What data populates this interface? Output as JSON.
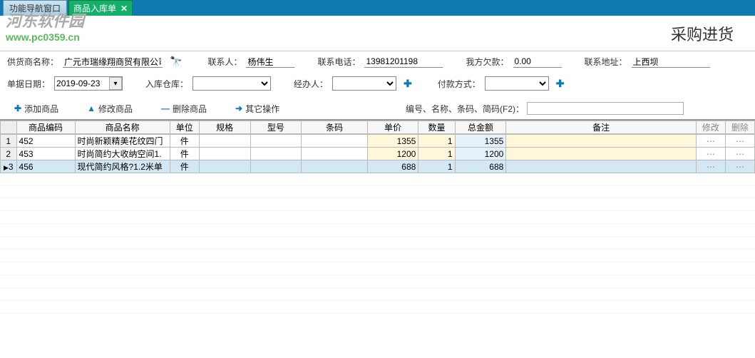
{
  "tabs": {
    "inactive": "功能导航窗口",
    "active": "商品入库单",
    "close": "✕"
  },
  "watermark": {
    "cn": "河东软件园",
    "url": "www.pc0359.cn"
  },
  "page_title": "采购进货",
  "form": {
    "supplier_lbl": "供货商名称：",
    "supplier": "广元市瑞缘翔商贸有限公司",
    "contact_lbl": "联系人：",
    "contact": "杨伟生",
    "phone_lbl": "联系电话：",
    "phone": "13981201198",
    "debt_lbl": "我方欠款：",
    "debt": "0.00",
    "addr_lbl": "联系地址：",
    "addr": "上西坝",
    "date_lbl": "单据日期：",
    "date": "2019-09-23",
    "wh_lbl": "入库仓库：",
    "handler_lbl": "经办人：",
    "pay_lbl": "付款方式："
  },
  "toolbar": {
    "add": "添加商品",
    "edit": "修改商品",
    "del": "删除商品",
    "other": "其它操作",
    "search_lbl": "编号、名称、条码、简码(F2)："
  },
  "grid": {
    "headers": {
      "code": "商品编码",
      "name": "商品名称",
      "unit": "单位",
      "spec": "规格",
      "model": "型号",
      "barcode": "条码",
      "price": "单价",
      "qty": "数量",
      "total": "总金额",
      "remark": "备注",
      "mod": "修改",
      "del": "删除"
    },
    "rows": [
      {
        "n": "1",
        "code": "452",
        "name": "时尚新颖精美花纹四门",
        "unit": "件",
        "price": "1355",
        "qty": "1",
        "total": "1355"
      },
      {
        "n": "2",
        "code": "453",
        "name": "时尚简约大收纳空间1.",
        "unit": "件",
        "price": "1200",
        "qty": "1",
        "total": "1200"
      },
      {
        "n": "3",
        "code": "456",
        "name": "现代简约风格?1.2米单",
        "unit": "件",
        "price": "688",
        "qty": "1",
        "total": "688",
        "selected": true
      }
    ]
  }
}
